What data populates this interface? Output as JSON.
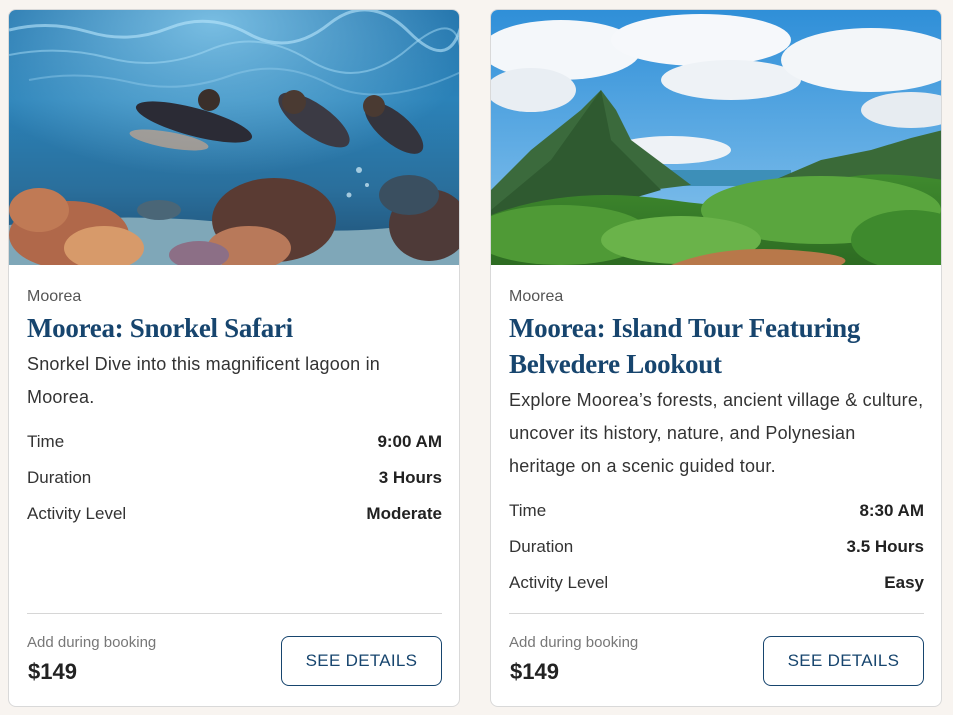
{
  "cards": [
    {
      "image_alt": "Snorkelers swimming over a coral reef",
      "location": "Moorea",
      "title": "Moorea: Snorkel Safari",
      "description": "Snorkel Dive into this magnificent lagoon in Moorea.",
      "specs": [
        {
          "label": "Time",
          "value": "9:00 AM"
        },
        {
          "label": "Duration",
          "value": "3 Hours"
        },
        {
          "label": "Activity Level",
          "value": "Moderate"
        }
      ],
      "add_label": "Add during booking",
      "price": "$149",
      "button_label": "SEE DETAILS"
    },
    {
      "image_alt": "Green mountain and valley view from Belvedere Lookout",
      "location": "Moorea",
      "title": "Moorea: Island Tour Featuring Belvedere Lookout",
      "description": "Explore Moorea’s forests, ancient village & culture, uncover its history, nature, and Polynesian heritage on a scenic guided tour.",
      "specs": [
        {
          "label": "Time",
          "value": "8:30 AM"
        },
        {
          "label": "Duration",
          "value": "3.5 Hours"
        },
        {
          "label": "Activity Level",
          "value": "Easy"
        }
      ],
      "add_label": "Add during booking",
      "price": "$149",
      "button_label": "SEE DETAILS"
    }
  ],
  "colors": {
    "title": "#17456e",
    "button_border": "#17456e",
    "page_background": "#f8f4f0"
  }
}
